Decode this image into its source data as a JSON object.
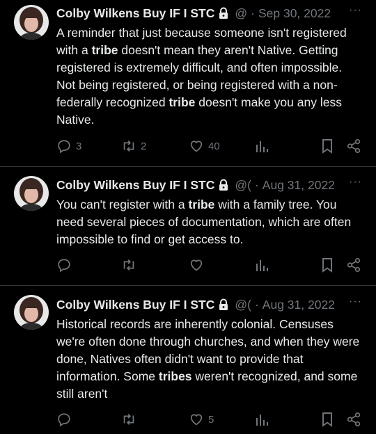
{
  "tweets": [
    {
      "author": "Colby Wilkens Buy IF I STC",
      "handle": "@",
      "date": "Sep 30, 2022",
      "body": [
        {
          "t": "A reminder that just because someone isn't registered with a "
        },
        {
          "t": "tribe",
          "b": true
        },
        {
          "t": " doesn't mean they aren't Native. Getting registered is extremely difficult, and often impossible. Not being registered, or being registered with a non-federally recognized "
        },
        {
          "t": "tribe",
          "b": true
        },
        {
          "t": " doesn't make you any less Native."
        }
      ],
      "replies": "3",
      "retweets": "2",
      "likes": "40"
    },
    {
      "author": "Colby Wilkens Buy IF I STC",
      "handle": "@(",
      "date": "Aug 31, 2022",
      "body": [
        {
          "t": "You can't register with a "
        },
        {
          "t": "tribe",
          "b": true
        },
        {
          "t": " with a family tree. You need several pieces of documentation, which are often impossible to find or get access to."
        }
      ],
      "replies": "",
      "retweets": "",
      "likes": ""
    },
    {
      "author": "Colby Wilkens Buy IF I STC",
      "handle": "@(",
      "date": "Aug 31, 2022",
      "body": [
        {
          "t": "Historical records are inherently colonial. Censuses we're often done through churches, and when they were done, Natives often didn't want to provide that information. Some "
        },
        {
          "t": "tribes",
          "b": true
        },
        {
          "t": " weren't recognized, and some still aren't"
        }
      ],
      "replies": "",
      "retweets": "",
      "likes": "5"
    }
  ],
  "separator": "·",
  "more_glyph": "···",
  "icons": [
    "lock-icon",
    "reply-icon",
    "retweet-icon",
    "like-icon",
    "views-icon",
    "bookmark-icon",
    "share-icon"
  ]
}
